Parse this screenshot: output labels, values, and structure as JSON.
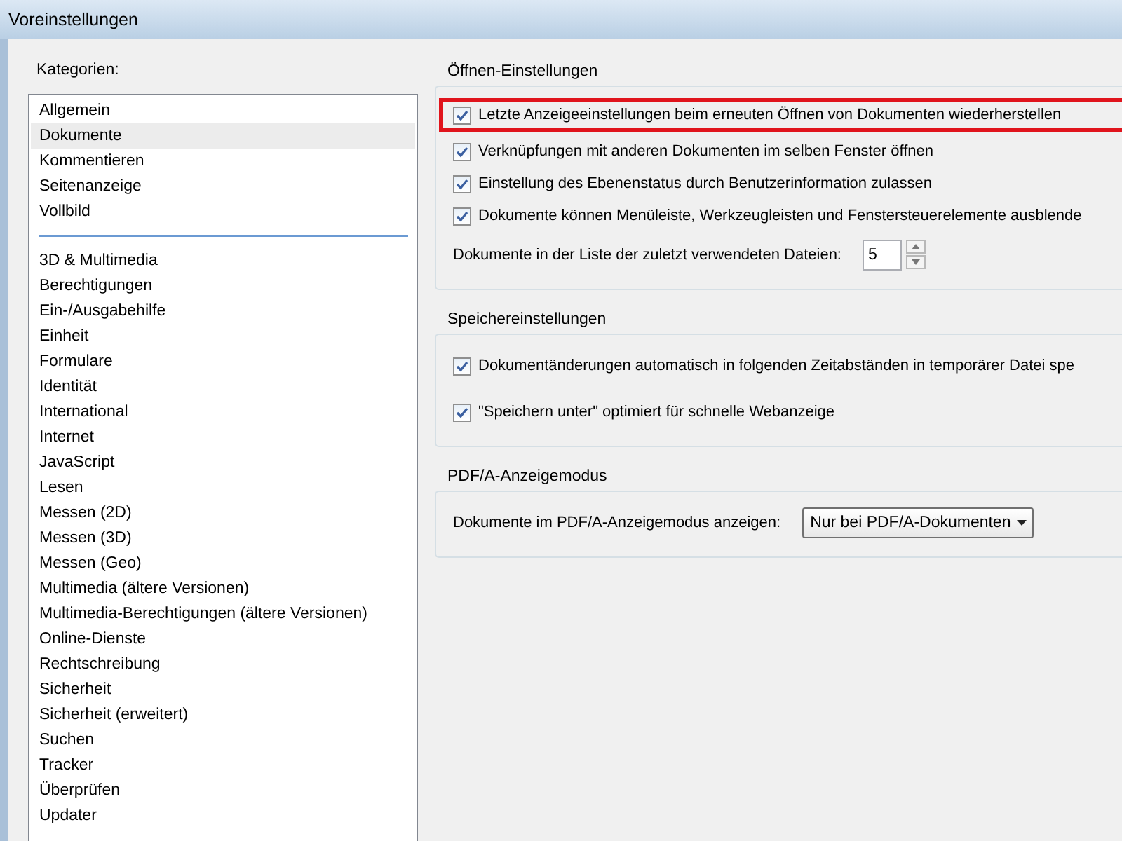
{
  "window": {
    "title": "Voreinstellungen"
  },
  "categories": {
    "label": "Kategorien:",
    "groups": [
      [
        {
          "label": "Allgemein",
          "selected": false
        },
        {
          "label": "Dokumente",
          "selected": true
        },
        {
          "label": "Kommentieren",
          "selected": false
        },
        {
          "label": "Seitenanzeige",
          "selected": false
        },
        {
          "label": "Vollbild",
          "selected": false
        }
      ],
      [
        {
          "label": "3D & Multimedia",
          "selected": false
        },
        {
          "label": "Berechtigungen",
          "selected": false
        },
        {
          "label": "Ein-/Ausgabehilfe",
          "selected": false
        },
        {
          "label": "Einheit",
          "selected": false
        },
        {
          "label": "Formulare",
          "selected": false
        },
        {
          "label": "Identität",
          "selected": false
        },
        {
          "label": "International",
          "selected": false
        },
        {
          "label": "Internet",
          "selected": false
        },
        {
          "label": "JavaScript",
          "selected": false
        },
        {
          "label": "Lesen",
          "selected": false
        },
        {
          "label": "Messen (2D)",
          "selected": false
        },
        {
          "label": "Messen (3D)",
          "selected": false
        },
        {
          "label": "Messen (Geo)",
          "selected": false
        },
        {
          "label": "Multimedia (ältere Versionen)",
          "selected": false
        },
        {
          "label": "Multimedia-Berechtigungen (ältere Versionen)",
          "selected": false
        },
        {
          "label": "Online-Dienste",
          "selected": false
        },
        {
          "label": "Rechtschreibung",
          "selected": false
        },
        {
          "label": "Sicherheit",
          "selected": false
        },
        {
          "label": "Sicherheit (erweitert)",
          "selected": false
        },
        {
          "label": "Suchen",
          "selected": false
        },
        {
          "label": "Tracker",
          "selected": false
        },
        {
          "label": "Überprüfen",
          "selected": false
        },
        {
          "label": "Updater",
          "selected": false
        }
      ]
    ]
  },
  "sections": [
    {
      "title": "Öffnen-Einstellungen",
      "items": [
        {
          "kind": "checkbox",
          "label": "Letzte Anzeigeeinstellungen beim erneuten Öffnen von Dokumenten wiederherstellen",
          "checked": true,
          "highlighted": true
        },
        {
          "kind": "checkbox",
          "label": "Verknüpfungen mit anderen Dokumenten im selben Fenster öffnen",
          "checked": true,
          "highlighted": false
        },
        {
          "kind": "checkbox",
          "label": "Einstellung des Ebenenstatus durch Benutzerinformation zulassen",
          "checked": true,
          "highlighted": false
        },
        {
          "kind": "checkbox",
          "label": "Dokumente können Menüleiste, Werkzeugleisten und Fenstersteuerelemente ausblende",
          "checked": true,
          "highlighted": false
        },
        {
          "kind": "spinner",
          "label": "Dokumente in der Liste der zuletzt verwendeten Dateien:",
          "value": "5"
        }
      ]
    },
    {
      "title": "Speichereinstellungen",
      "items": [
        {
          "kind": "checkbox",
          "label": "Dokumentänderungen automatisch in folgenden Zeitabständen in temporärer Datei spe",
          "checked": true,
          "highlighted": false
        },
        {
          "kind": "checkbox",
          "label": "\"Speichern unter\" optimiert für schnelle Webanzeige",
          "checked": true,
          "highlighted": false
        }
      ]
    },
    {
      "title": "PDF/A-Anzeigemodus",
      "items": [
        {
          "kind": "dropdown",
          "label": "Dokumente im PDF/A-Anzeigemodus anzeigen:",
          "value": "Nur bei PDF/A-Dokumenten"
        }
      ]
    }
  ]
}
